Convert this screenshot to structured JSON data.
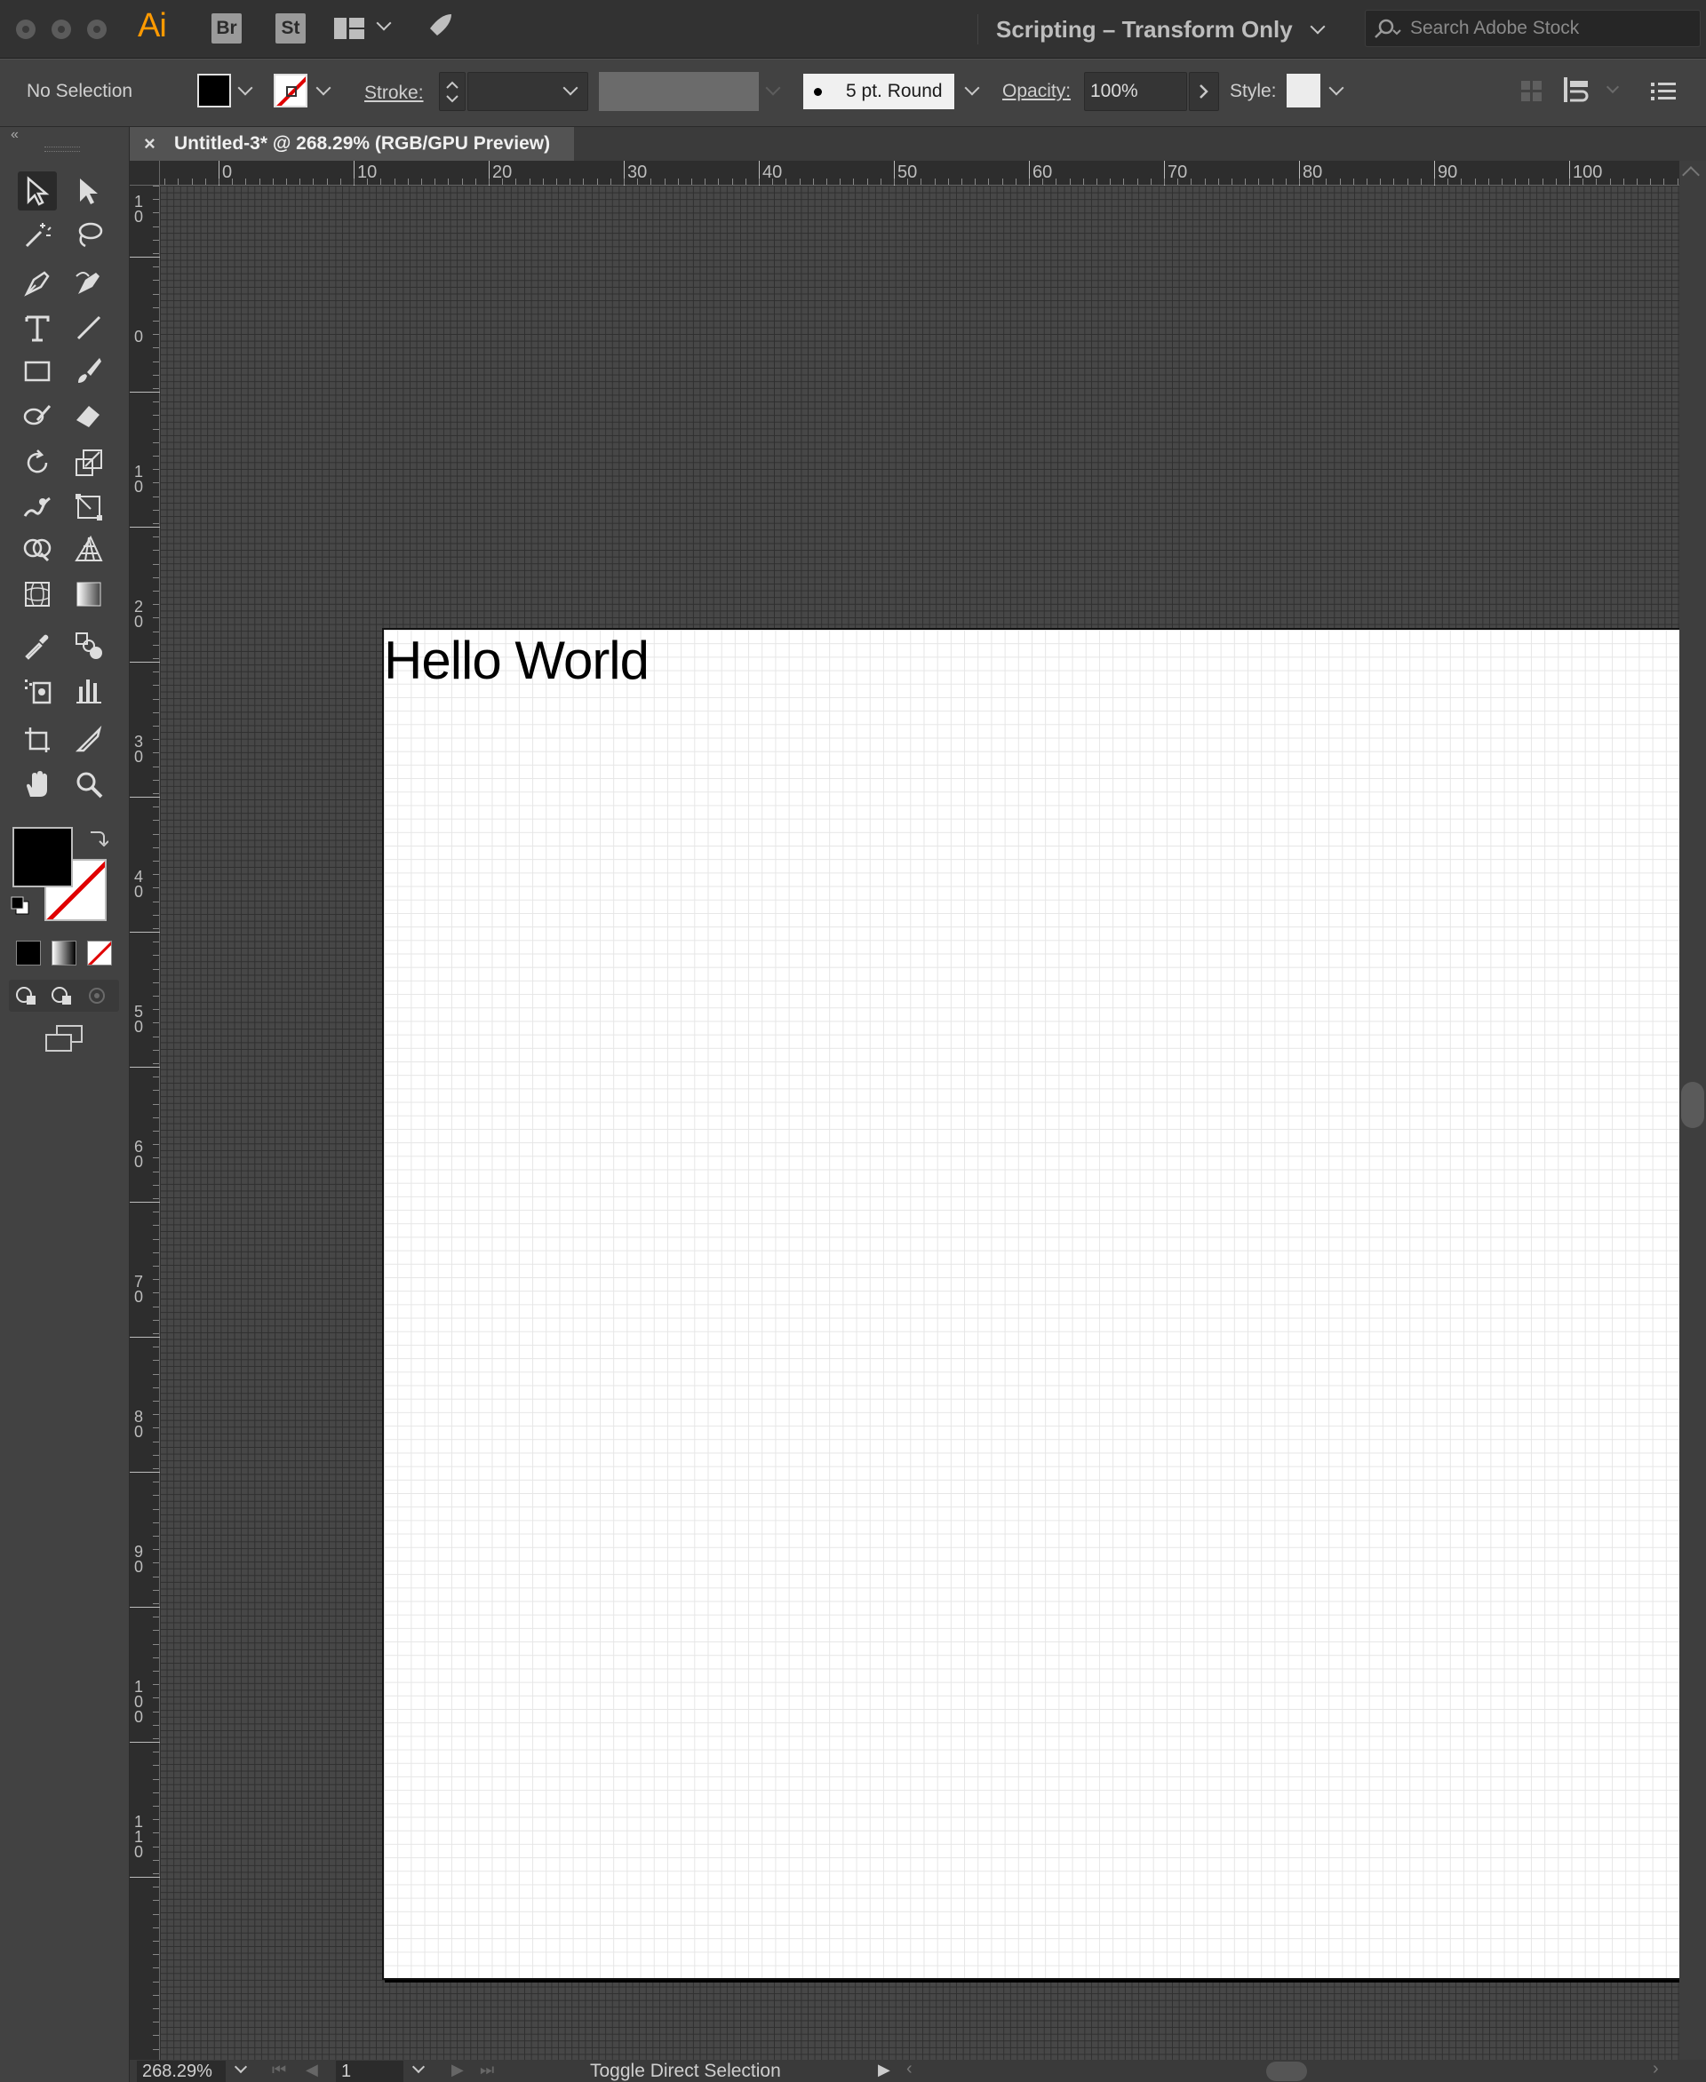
{
  "app": {
    "logo": "Ai",
    "bridge_label": "Br",
    "stock_label": "St",
    "workspace": "Scripting – Transform Only",
    "search_placeholder": "Search Adobe Stock"
  },
  "control_bar": {
    "selection_status": "No Selection",
    "stroke_label": "Stroke:",
    "brush_label": "5 pt. Round",
    "opacity_label": "Opacity:",
    "opacity_value": "100%",
    "style_label": "Style:"
  },
  "document": {
    "tab_title": "Untitled-3* @ 268.29% (RGB/GPU Preview)",
    "artboard_text": "Hello World"
  },
  "rulers": {
    "horizontal": [
      "0",
      "10",
      "20",
      "30",
      "40",
      "50",
      "60",
      "70",
      "80",
      "90",
      "100"
    ],
    "vertical": [
      "1\n0",
      "0",
      "1\n0",
      "2\n0",
      "3\n0",
      "4\n0",
      "5\n0",
      "6\n0",
      "7\n0",
      "8\n0",
      "9\n0",
      "1\n0\n0",
      "1\n1\n0"
    ]
  },
  "status_bar": {
    "zoom": "268.29%",
    "artboard_number": "1",
    "status_text": "Toggle Direct Selection"
  },
  "tools": [
    "selection-tool",
    "direct-selection-tool",
    "magic-wand-tool",
    "lasso-tool",
    "pen-tool",
    "curvature-tool",
    "type-tool",
    "line-tool",
    "rectangle-tool",
    "paintbrush-tool",
    "shaper-tool",
    "eraser-tool",
    "rotate-tool",
    "scale-tool",
    "warp-tool",
    "free-transform-tool",
    "shape-builder-tool",
    "perspective-grid-tool",
    "mesh-tool",
    "gradient-tool",
    "eyedropper-tool",
    "blend-tool",
    "symbol-sprayer-tool",
    "column-graph-tool",
    "artboard-tool",
    "slice-tool",
    "hand-tool",
    "zoom-tool"
  ],
  "colors": {
    "fill": "#000000",
    "stroke": "none",
    "accent": "#ff9a00"
  }
}
